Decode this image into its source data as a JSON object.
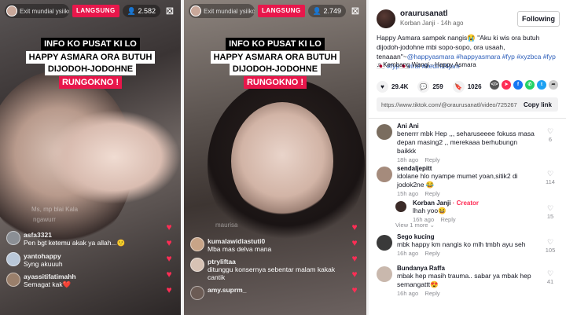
{
  "live1": {
    "host_name": "Exit mundial ysiikol",
    "badge": "LANGSUNG",
    "viewers": "2.582",
    "comments": [
      {
        "user": "asfa3321",
        "text": "Pen bgt ketemu akak  ya allah...🙂"
      },
      {
        "user": "yantohappy",
        "text": "Syng akuuuh"
      },
      {
        "user": "ayassitifatimahh",
        "text": "Semagat kak❤️"
      }
    ],
    "faded": [
      "Ms, mp blai Kala",
      "ngawurr"
    ]
  },
  "live2": {
    "host_name": "Exit mundial ysiikol",
    "badge": "LANGSUNG",
    "viewers": "2.749",
    "comments": [
      {
        "user": "kumalawidiastuti0",
        "text": "Mba mas delva mana"
      },
      {
        "user": "ptryliftaa",
        "text": "ditunggu konsernya sebentar malam kakak cantik"
      },
      {
        "user": "amy.suprm_",
        "text": ""
      }
    ],
    "faded": [
      "maurisa"
    ]
  },
  "captions": {
    "line1": "INFO KO PUSAT KI LO",
    "line2": "HAPPY ASMARA ORA BUTUH",
    "line3": "DIJODOH-JODOHNE",
    "line4": "RUNGOKNO !"
  },
  "side": {
    "username": "oraurusanatl",
    "subtitle": "Korban Janji · 14h ago",
    "follow_label": "Following",
    "caption_text": "Happy Asmara sampek nangis😭 \"Aku ki wis ora butuh dijodoh-jodohne mbi sopo-sopo, ora usaah, tenaaan\"~",
    "caption_tags": "@happyasmara #happyasmara #fyp #xyzbca #fyp🇯🇵 #fyp🇯🇵viral #kediri24jam",
    "music": "♫  Kembang Wangi - Happy Asmara",
    "stats": {
      "likes": "29.4K",
      "comments": "259",
      "saves": "1026"
    },
    "link_url": "https://www.tiktok.com/@oraurusanatl/video/7252673...",
    "copy_label": "Copy link",
    "comments": [
      {
        "name": "Ani Ani",
        "text": "benerrr mbk Hep ,,, seharuseeee fokuss masa depan masing2 ,, merekaaa berhubungn baikkk",
        "date": "18h ago",
        "reply": "Reply",
        "likes": "6",
        "avatar": "#7a6d5f"
      },
      {
        "name": "sendaljepitt",
        "text": "idolane hlo nyampe mumet yoan,sitik2 di jodok2ne 😂",
        "date": "15h ago",
        "reply": "Reply",
        "likes": "114",
        "avatar": "#a58b7c"
      },
      {
        "name": "Korban Janji",
        "creator": " · Creator",
        "text": "lhah yoo😆",
        "date": "16h ago",
        "reply": "Reply",
        "likes": "15",
        "avatar": "#3b2b28"
      },
      {
        "name": "Sego kucing",
        "text": "mbk happy km nangis ko mlh tmbh ayu seh",
        "date": "16h ago",
        "reply": "Reply",
        "likes": "105",
        "avatar": "#3a3a3a"
      },
      {
        "name": "Bundanya Raffa",
        "text": "mbak hep masih trauma.. sabar ya mbak hep semangattt😍",
        "date": "16h ago",
        "reply": "Reply",
        "likes": "41",
        "avatar": "#c9b8ad"
      }
    ],
    "view_more": "View 1 more ⌄"
  }
}
